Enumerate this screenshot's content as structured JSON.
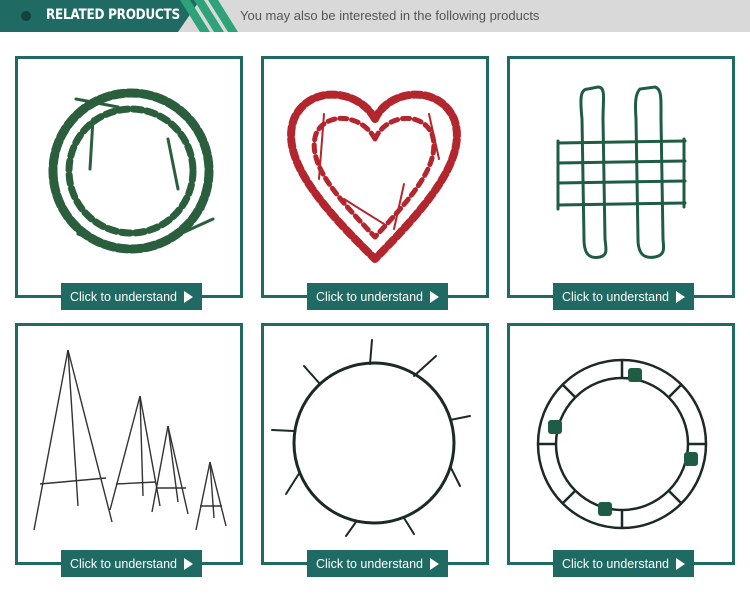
{
  "header": {
    "title": "RELATED PRODUCTS",
    "subtitle": "You may also be interested in the following products"
  },
  "colors": {
    "accent": "#1f6b63",
    "header_bg": "#d9d9d9",
    "wire_green": "#1f5c44",
    "wire_red": "#b3262d",
    "wire_black": "#222222"
  },
  "products": [
    {
      "image": "green-pine-wreath-frame",
      "cta_label": "Click to understand"
    },
    {
      "image": "red-heart-wreath-frame",
      "cta_label": "Click to understand"
    },
    {
      "image": "green-grid-wire-frame",
      "cta_label": "Click to understand"
    },
    {
      "image": "pyramid-topiary-frames",
      "cta_label": "Click to understand"
    },
    {
      "image": "clamp-wreath-ring",
      "cta_label": "Click to understand"
    },
    {
      "image": "double-ring-wreath-with-clips",
      "cta_label": "Click to understand"
    }
  ]
}
